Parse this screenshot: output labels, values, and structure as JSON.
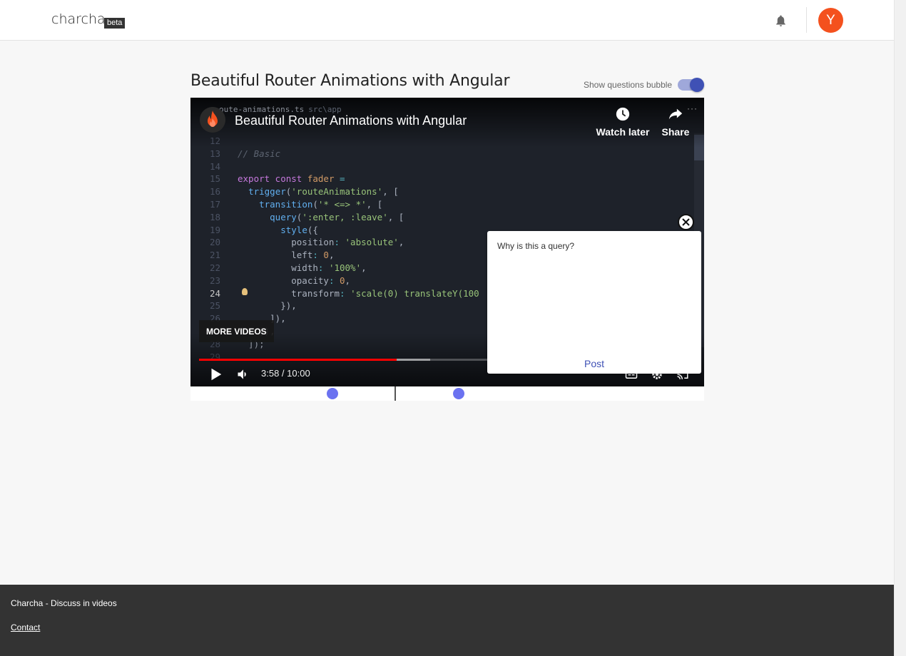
{
  "header": {
    "brand": "charcha",
    "badge": "beta",
    "avatar_initial": "Y"
  },
  "page": {
    "title": "Beautiful Router Animations with Angular",
    "toggle_label": "Show questions bubble",
    "toggle_on": true
  },
  "video": {
    "editor_tab_file": "oute-animations.ts",
    "editor_tab_path": "src\\app",
    "title": "Beautiful Router Animations with Angular",
    "watch_later": "Watch later",
    "share": "Share",
    "more_videos": "MORE VIDEOS",
    "time": "3:58 / 10:00",
    "progress_played": 0.398,
    "progress_buffered": 0.465,
    "code_lines": [
      {
        "n": "12",
        "html": ""
      },
      {
        "n": "13",
        "html": "<span class=\"cm\">// Basic</span>"
      },
      {
        "n": "14",
        "html": ""
      },
      {
        "n": "15",
        "html": "<span class=\"kw\">export const</span> <span class=\"num\">fader</span> <span class=\"op\">=</span>"
      },
      {
        "n": "16",
        "html": "  <span class=\"fn\">trigger</span>(<span class=\"str\">'routeAnimations'</span>, ["
      },
      {
        "n": "17",
        "html": "    <span class=\"fn\">transition</span>(<span class=\"str\">'* &lt;=&gt; *'</span>, ["
      },
      {
        "n": "18",
        "html": "      <span class=\"fn\">query</span>(<span class=\"str\">':enter, :leave'</span>, ["
      },
      {
        "n": "19",
        "html": "        <span class=\"fn\">style</span>({"
      },
      {
        "n": "20",
        "html": "          position<span class=\"op\">:</span> <span class=\"str\">'absolute'</span>,"
      },
      {
        "n": "21",
        "html": "          left<span class=\"op\">:</span> <span class=\"num\">0</span>,"
      },
      {
        "n": "22",
        "html": "          width<span class=\"op\">:</span> <span class=\"str\">'100%'</span>,"
      },
      {
        "n": "23",
        "html": "          opacity<span class=\"op\">:</span> <span class=\"num\">0</span>,"
      },
      {
        "n": "24",
        "html": "          transform<span class=\"op\">:</span> <span class=\"str\">'scale(0) translateY(100</span>"
      },
      {
        "n": "25",
        "html": "        }),"
      },
      {
        "n": "26",
        "html": "      ]),"
      },
      {
        "n": "27",
        "html": "    ]),"
      },
      {
        "n": "28",
        "html": "  ]);"
      },
      {
        "n": "29",
        "html": ""
      }
    ]
  },
  "question": {
    "text": "Why is this a query?",
    "post_label": "Post"
  },
  "timeline": {
    "marker_positions": [
      0.277,
      0.522
    ],
    "current_position": 0.398
  },
  "footer": {
    "tagline": "Charcha - Discuss in videos",
    "contact": "Contact"
  },
  "colors": {
    "accent": "#3f51b5",
    "avatar": "#f4511e",
    "marker": "#6b72f0",
    "progress": "#ff0000"
  }
}
